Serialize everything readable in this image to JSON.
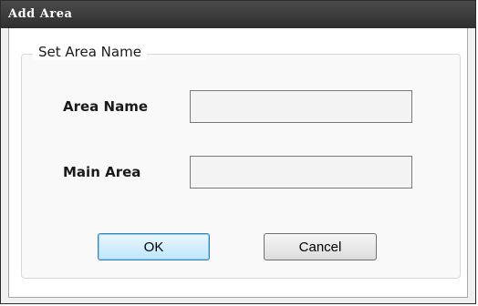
{
  "window": {
    "title": "Add Area"
  },
  "group": {
    "legend": "Set Area Name"
  },
  "fields": {
    "area_name": {
      "label": "Area Name",
      "value": "",
      "placeholder": ""
    },
    "main_area": {
      "label": "Main Area",
      "value": "",
      "placeholder": ""
    }
  },
  "buttons": {
    "ok_label": "OK",
    "cancel_label": "Cancel"
  },
  "colors": {
    "titlebar": "#333333",
    "default_button_border": "#3c7fb1"
  }
}
